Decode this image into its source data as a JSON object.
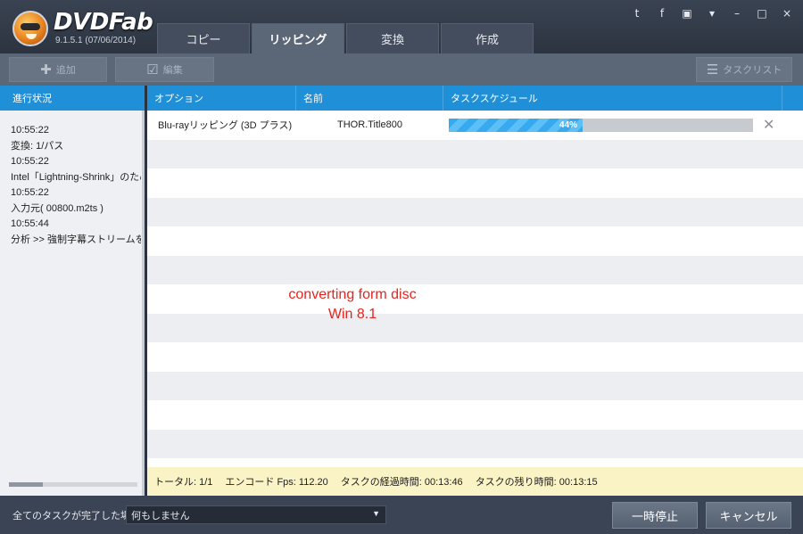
{
  "app": {
    "brand": "DVDFab",
    "version": "9.1.5.1 (07/06/2014)",
    "tabs": [
      {
        "label": "コピー"
      },
      {
        "label": "リッピング"
      },
      {
        "label": "変換"
      },
      {
        "label": "作成"
      }
    ],
    "active_tab": "リッピング",
    "top_icons": {
      "twitter": "t",
      "facebook": "f",
      "youtube": "▣",
      "menu": "▾",
      "minimize": "–",
      "maximize": "□",
      "close": "×"
    }
  },
  "toolbar": {
    "add_label": "追加",
    "edit_label": "編集",
    "tasklist_label": "タスクリスト"
  },
  "left_panel": {
    "header": "進行状況",
    "log": [
      "10:55:22",
      "変換: 1/パス",
      "10:55:22",
      "Intel「Lightning-Shrink」のため",
      "10:55:22",
      "入力元( 00800.m2ts )",
      "10:55:44",
      "分析 >> 強制字幕ストリームを"
    ]
  },
  "table": {
    "headers": [
      "オプション",
      "名前",
      "タスクスケジュール"
    ],
    "rows": [
      {
        "option": "Blu-rayリッピング (3D プラス)",
        "name": "THOR.Title800",
        "progress": 44,
        "progress_label": "44%"
      }
    ],
    "empty_row_count": 11
  },
  "overlay": {
    "line1": "converting form disc",
    "line2": "Win 8.1"
  },
  "status": {
    "total": "トータル: 1/1",
    "fps": "エンコード Fps: 112.20",
    "elapsed": "タスクの経過時間: 00:13:46",
    "remaining": "タスクの残り時間: 00:13:15"
  },
  "bottom": {
    "completion_label": "全てのタスクが完了した場合:",
    "completion_value": "何もしません",
    "pause_label": "一時停止",
    "cancel_label": "キャンセル"
  },
  "colors": {
    "accent": "#1f8fd8",
    "progress_fill": "#37a9ef",
    "overlay_text": "#e8231d",
    "status_bg": "#faf3c5"
  }
}
